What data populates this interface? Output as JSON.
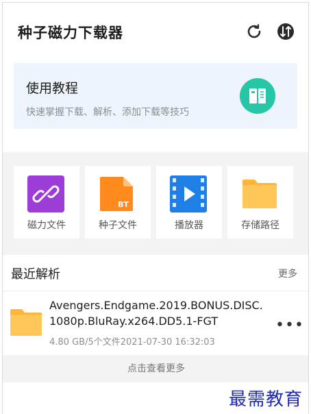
{
  "header": {
    "title": "种子磁力下载器"
  },
  "tutorial": {
    "title": "使用教程",
    "subtitle": "快速掌握下载、解析、添加下载等技巧"
  },
  "tiles": [
    {
      "label": "磁力文件",
      "color": "#9b3dd6"
    },
    {
      "label": "种子文件",
      "color": "#ff8a1d",
      "badge": "BT"
    },
    {
      "label": "播放器",
      "color": "#1e7fe6"
    },
    {
      "label": "存储路径",
      "color": "#ffb43a"
    }
  ],
  "recent": {
    "title": "最近解析",
    "more_label": "更多",
    "item": {
      "name_line1": "Avengers.Endgame.2019.BONUS.DISC.",
      "name_line2": "1080p.BluRay.x264.DD5.1-FGT",
      "meta": "4.80 GB/5个文件2021-07-30 16:32:03"
    },
    "view_more": "点击查看更多"
  },
  "watermark": "最需教育"
}
